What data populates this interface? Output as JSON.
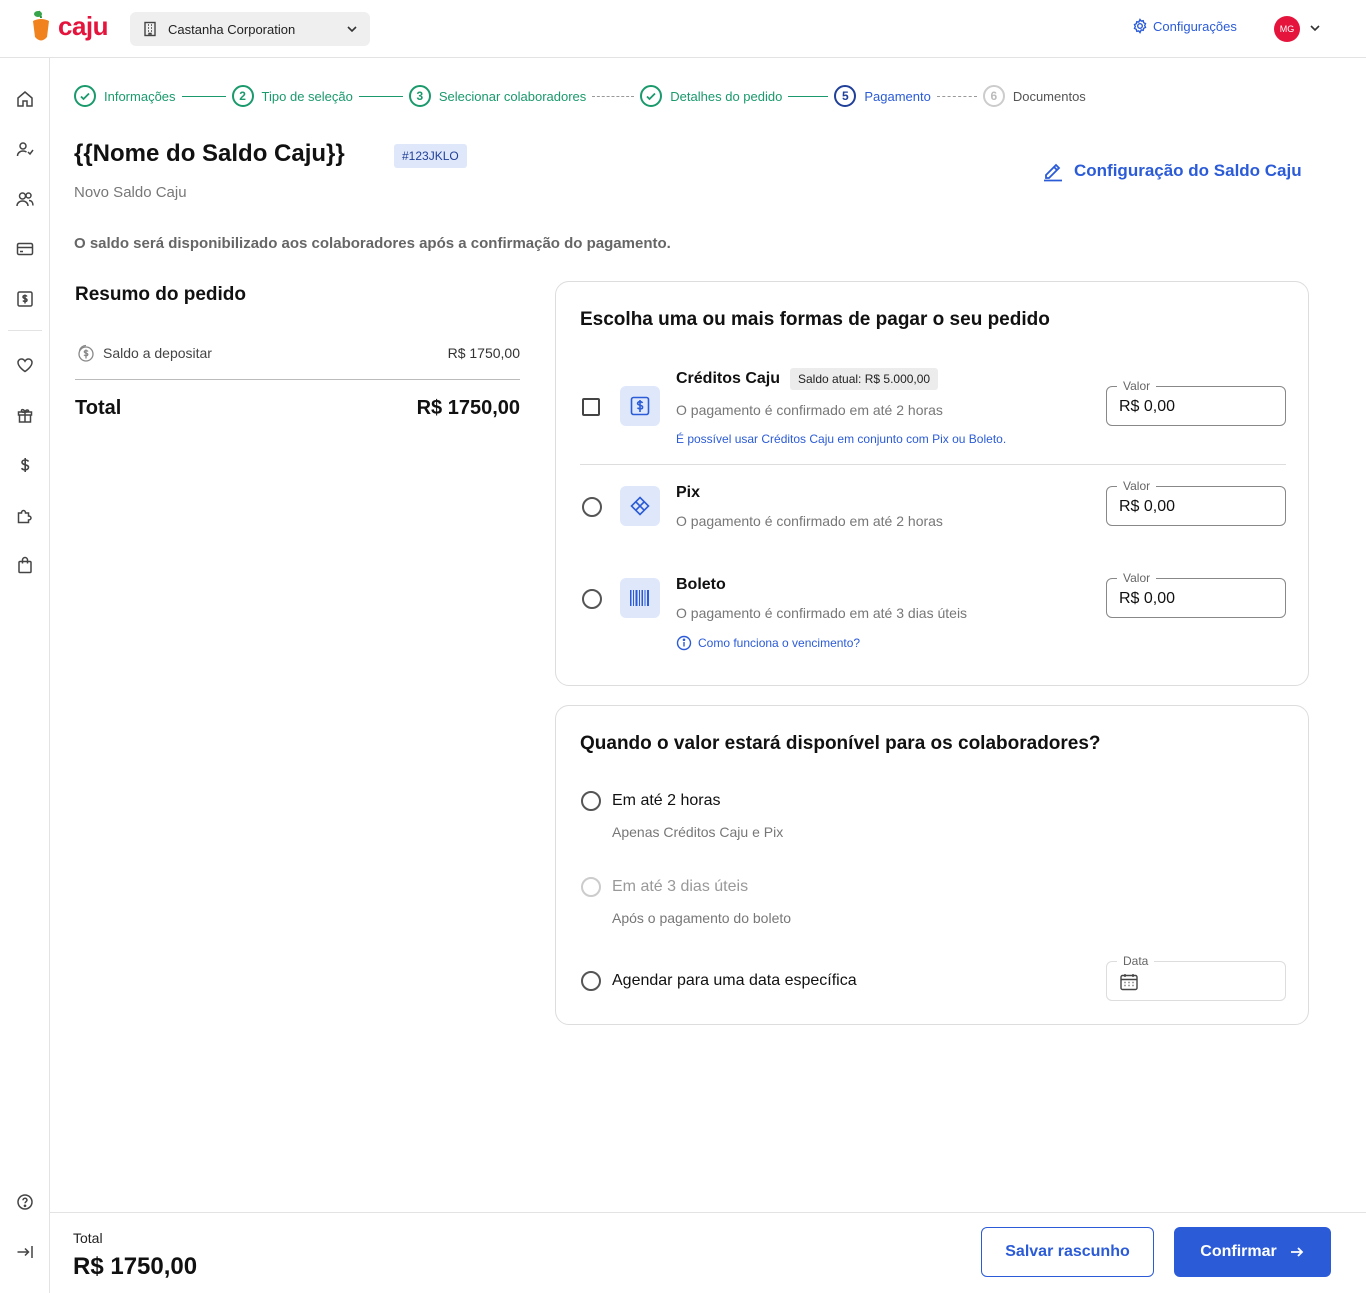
{
  "brand": {
    "name": "caju",
    "color": "#e4143c",
    "accent": "#2b5bd7"
  },
  "header": {
    "company": "Castanha Corporation",
    "settings_label": "Configurações",
    "avatar_initials": "MG"
  },
  "sidebar": {
    "icons": [
      "home-icon",
      "user-icon",
      "users-icon",
      "card-icon",
      "money-icon",
      "heart-icon",
      "gift-icon",
      "dollar-icon",
      "puzzle-icon",
      "bag-icon",
      "help-icon",
      "collapse-icon"
    ]
  },
  "stepper": {
    "steps": [
      {
        "number": "",
        "label": "Informações",
        "state": "done"
      },
      {
        "number": "2",
        "label": "Tipo de seleção",
        "state": "done"
      },
      {
        "number": "3",
        "label": "Selecionar colaboradores",
        "state": "done"
      },
      {
        "number": "",
        "label": "Detalhes do pedido",
        "state": "done"
      },
      {
        "number": "5",
        "label": "Pagamento",
        "state": "active"
      },
      {
        "number": "6",
        "label": "Documentos",
        "state": "pending"
      }
    ]
  },
  "page": {
    "title": "{{Nome do Saldo Caju}}",
    "tag": "#123JKLO",
    "subtitle": "Novo Saldo Caju",
    "config_link": "Configuração do Saldo Caju",
    "info": "O saldo será disponibilizado aos colaboradores após a confirmação do pagamento."
  },
  "summary": {
    "title": "Resumo do pedido",
    "item_label": "Saldo a depositar",
    "item_value": "R$ 1750,00",
    "total_label": "Total",
    "total_value": "R$ 1750,00"
  },
  "payment": {
    "title": "Escolha uma ou mais formas de pagar o seu pedido",
    "field_label": "Valor",
    "options": [
      {
        "name": "Créditos Caju",
        "balance": "Saldo atual: R$ 5.000,00",
        "desc": "O pagamento é confirmado em até 2 horas",
        "note": "É possível usar Créditos Caju em conjunto com Pix ou Boleto.",
        "value": "R$ 0,00"
      },
      {
        "name": "Pix",
        "desc": "O pagamento é confirmado em até 2 horas",
        "value": "R$ 0,00"
      },
      {
        "name": "Boleto",
        "desc": "O pagamento é confirmado em até 3 dias úteis",
        "note": "Como funciona o vencimento?",
        "value": "R$ 0,00"
      }
    ]
  },
  "availability": {
    "title": "Quando o valor estará disponível para os colaboradores?",
    "options": [
      {
        "label": "Em até 2 horas",
        "sub": "Apenas Créditos Caju e Pix",
        "disabled": false
      },
      {
        "label": "Em até 3 dias úteis",
        "sub": "Após o pagamento do boleto",
        "disabled": true
      },
      {
        "label": "Agendar para uma data específica",
        "sub": "",
        "disabled": false
      }
    ],
    "date_label": "Data"
  },
  "footer": {
    "total_label": "Total",
    "total_value": "R$ 1750,00",
    "save_label": "Salvar rascunho",
    "confirm_label": "Confirmar"
  }
}
